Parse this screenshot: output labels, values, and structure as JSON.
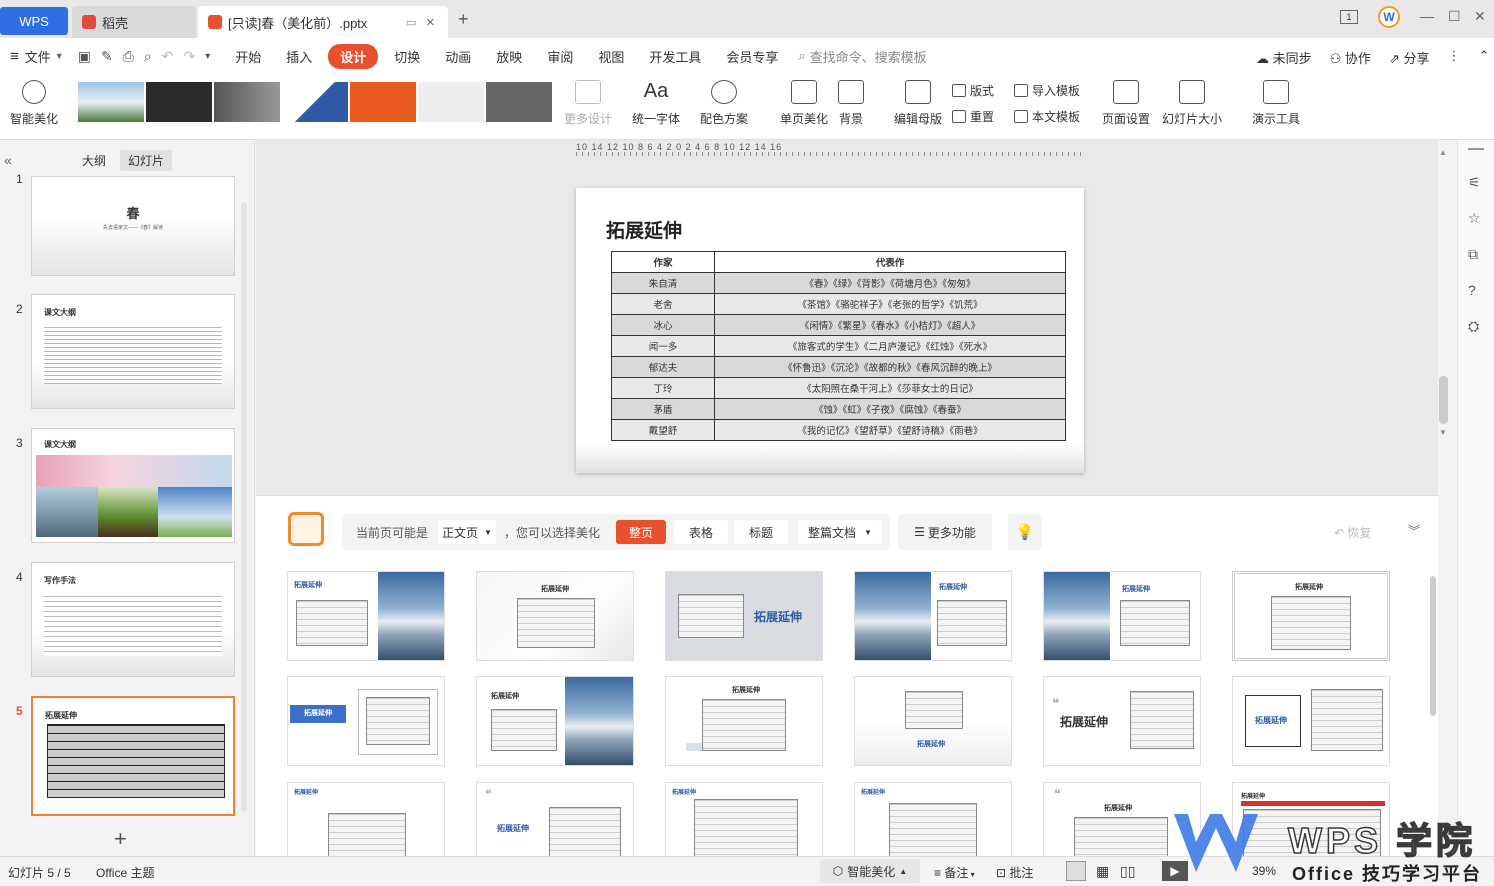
{
  "titlebar": {
    "wps_tab": "WPS",
    "doc_tab": "稻壳",
    "active_tab": "[只读]春（美化前）.pptx",
    "new_tab": "+",
    "badge": "1"
  },
  "menu": {
    "file": "文件",
    "items": [
      "开始",
      "插入",
      "设计",
      "切换",
      "动画",
      "放映",
      "审阅",
      "视图",
      "开发工具",
      "会员专享"
    ],
    "active": "设计",
    "search_placeholder": "查找命令、搜索模板",
    "sync": "未同步",
    "collab": "协作",
    "share": "分享"
  },
  "ribbon": {
    "smart": "智能美化",
    "more_design": "更多设计",
    "font": "统一字体",
    "color": "配色方案",
    "page_beautify": "单页美化",
    "background": "背景",
    "edit_master": "编辑母版",
    "layout": "版式",
    "reset": "重置",
    "import_template": "导入模板",
    "this_template": "本文模板",
    "page_setup": "页面设置",
    "slide_size": "幻灯片大小",
    "present_tools": "演示工具"
  },
  "sidebar": {
    "tab_outline": "大纲",
    "tab_slides": "幻灯片",
    "slides": [
      {
        "num": "1",
        "title": "春",
        "subtitle": "失去语家文——《春》解读"
      },
      {
        "num": "2",
        "title": "课文大纲"
      },
      {
        "num": "3",
        "title": "课文大纲"
      },
      {
        "num": "4",
        "title": "写作手法"
      },
      {
        "num": "5",
        "title": "拓展延伸"
      }
    ],
    "add": "+"
  },
  "ruler": "10 14 12 10 8 6 4 2 0 2 4 6 8 10 12 14 16",
  "slide": {
    "title": "拓展延伸",
    "headers": [
      "作家",
      "代表作"
    ],
    "rows": [
      [
        "朱自清",
        "《春》《绿》《背影》《荷塘月色》《匆匆》"
      ],
      [
        "老舍",
        "《茶馆》《骆驼祥子》《老张的哲学》《饥荒》"
      ],
      [
        "冰心",
        "《闲情》《繁星》《春水》《小桔灯》《超人》"
      ],
      [
        "闻一多",
        "《旅客式的学生》《二月庐漫记》《红烛》《死水》"
      ],
      [
        "郁达夫",
        "《怀鲁迅》《沉沦》《故都的秋》《春风沉醉的晚上》"
      ],
      [
        "丁玲",
        "《太阳照在桑干河上》《莎菲女士的日记》"
      ],
      [
        "茅盾",
        "《蚀》《虹》《子夜》《腐蚀》《春蚕》"
      ],
      [
        "戴望舒",
        "《我的记忆》《望舒草》《望舒诗稿》《雨巷》"
      ]
    ]
  },
  "beautify": {
    "prompt": "当前页可能是",
    "page_type": "正文页",
    "prompt2": "，您可以选择美化",
    "btn_whole": "整页",
    "btn_table": "表格",
    "btn_title": "标题",
    "btn_doc": "整篇文档",
    "btn_more": "更多功能",
    "restore": "恢复",
    "card_title": "拓展延伸"
  },
  "statusbar": {
    "slide_info": "幻灯片 5 / 5",
    "theme": "Office 主题",
    "smart": "智能美化",
    "notes": "备注",
    "comment": "批注",
    "zoom": "39%"
  },
  "watermark": {
    "brand": "WPS 学院",
    "tagline": "Office 技巧学习平台"
  }
}
